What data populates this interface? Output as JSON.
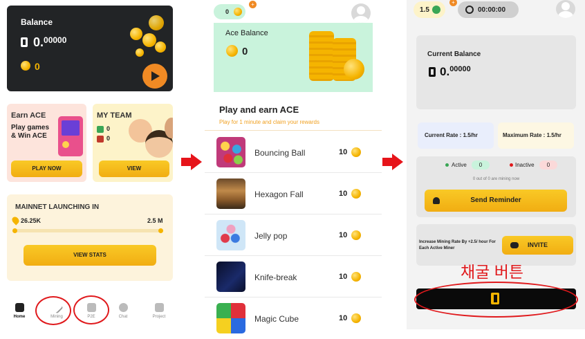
{
  "panel1": {
    "balance": {
      "title": "Balance",
      "amount_main": "0.",
      "amount_dec": "00000",
      "coins": "0"
    },
    "earn_ace": {
      "title": "Earn ACE",
      "subtitle_line1": "Play games",
      "subtitle_line2": "& Win ACE",
      "button": "PLAY NOW"
    },
    "my_team": {
      "title": "MY TEAM",
      "count_a": "0",
      "count_b": "0",
      "button": "VIEW"
    },
    "mainnet": {
      "title": "MAINNET LAUNCHING IN",
      "current": "26.25K",
      "target": "2.5 M",
      "button": "VIEW STATS"
    },
    "nav": [
      {
        "label": "Home"
      },
      {
        "label": "Mining"
      },
      {
        "label": "P2E"
      },
      {
        "label": "Chat"
      },
      {
        "label": "Project"
      }
    ]
  },
  "panel2": {
    "top_count": "0",
    "ace_balance": {
      "title": "Ace Balance",
      "value": "0"
    },
    "heading": "Play and earn ACE",
    "subheading": "Play for 1 minute and claim your rewards",
    "games": [
      {
        "name": "Bouncing Ball",
        "reward": "10"
      },
      {
        "name": "Hexagon Fall",
        "reward": "10"
      },
      {
        "name": "Jelly pop",
        "reward": "10"
      },
      {
        "name": "Knife-break",
        "reward": "10"
      },
      {
        "name": "Magic Cube",
        "reward": "10"
      }
    ]
  },
  "panel3": {
    "rate_badge": "1.5",
    "timer": "00:00:00",
    "current_balance": {
      "title": "Current Balance",
      "amount_main": "0.",
      "amount_dec": "00000"
    },
    "current_rate": "Current Rate : 1.5/hr",
    "maximum_rate": "Maximum Rate : 1.5/hr",
    "active_label": "Active",
    "active_count": "0",
    "inactive_label": "Inactive",
    "inactive_count": "0",
    "mining_now": "0 out of 0 are mining now",
    "send_reminder": "Send Reminder",
    "increase_text": "Increase Mining Rate By +2.5/ hour For Each Active Miner",
    "invite": "INVITE",
    "annotation": "채굴 버튼"
  },
  "colors": {
    "accent_yellow": "#f5b400",
    "highlight_red": "#e0191c",
    "dark_card": "#222426",
    "mint": "#c9f3dc"
  }
}
